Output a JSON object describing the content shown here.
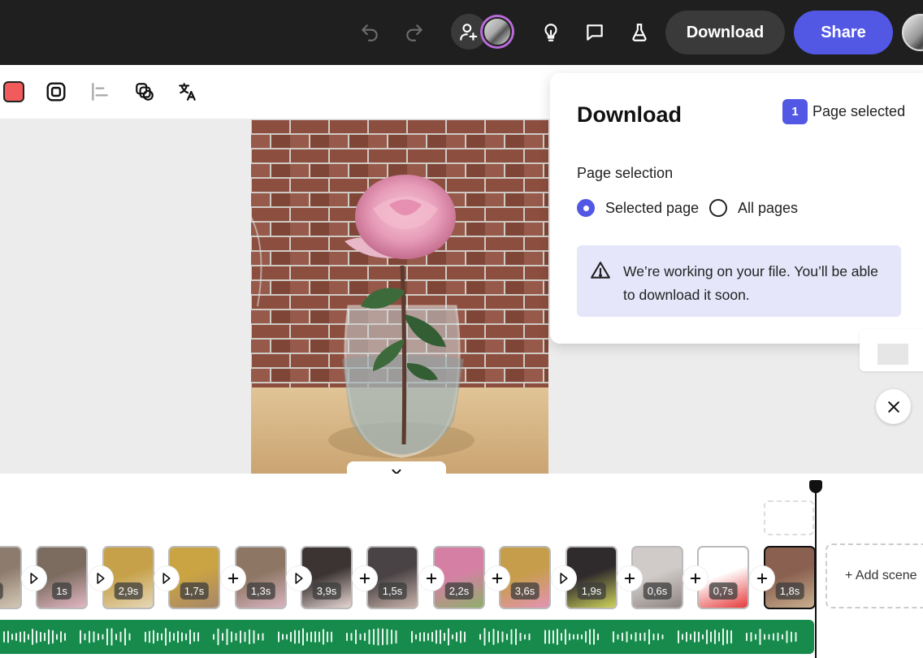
{
  "topbar": {
    "download_label": "Download",
    "share_label": "Share"
  },
  "panel": {
    "title": "Download",
    "selected_count": "1",
    "selected_text": "Page selected",
    "section_label": "Page selection",
    "options": [
      "Selected page",
      "All pages"
    ],
    "selected_option": "Selected page",
    "notice": "We’re working on your file. You’ll be able to download it soon."
  },
  "timeline": {
    "scenes": [
      {
        "duration": "s",
        "colors": [
          "#8d7b6e",
          "#d5c9b5"
        ],
        "selected": false
      },
      {
        "duration": "1s",
        "colors": [
          "#7c6c60",
          "#e2b7c4"
        ],
        "selected": false
      },
      {
        "duration": "2,9s",
        "colors": [
          "#c6a14a",
          "#e6d7b8"
        ],
        "selected": false
      },
      {
        "duration": "1,7s",
        "colors": [
          "#caa343",
          "#a6866a"
        ],
        "selected": false
      },
      {
        "duration": "1,3s",
        "colors": [
          "#8d7664",
          "#d9b4c0"
        ],
        "selected": false
      },
      {
        "duration": "3,9s",
        "colors": [
          "#3b3433",
          "#e7d7d2"
        ],
        "selected": false
      },
      {
        "duration": "1,5s",
        "colors": [
          "#4a4346",
          "#c9b3aa"
        ],
        "selected": false
      },
      {
        "duration": "2,2s",
        "colors": [
          "#d67fa5",
          "#8fae6b"
        ],
        "selected": false
      },
      {
        "duration": "3,6s",
        "colors": [
          "#c69d4a",
          "#e493b4"
        ],
        "selected": false
      },
      {
        "duration": "1,9s",
        "colors": [
          "#2f2a2c",
          "#cfd35a"
        ],
        "selected": false
      },
      {
        "duration": "0,6s",
        "colors": [
          "#d0cbc8",
          "#8f8582"
        ],
        "selected": false
      },
      {
        "duration": "0,7s",
        "colors": [
          "#ffffff",
          "#e53a3a"
        ],
        "selected": false
      },
      {
        "duration": "1,8s",
        "colors": [
          "#8a6050",
          "#c9b08e"
        ],
        "selected": true
      }
    ],
    "connectors": [
      "transition",
      "transition",
      "transition",
      "add",
      "transition",
      "add",
      "add",
      "add",
      "transition",
      "add",
      "add",
      "add"
    ],
    "add_scene_label": "+ Add scene"
  }
}
